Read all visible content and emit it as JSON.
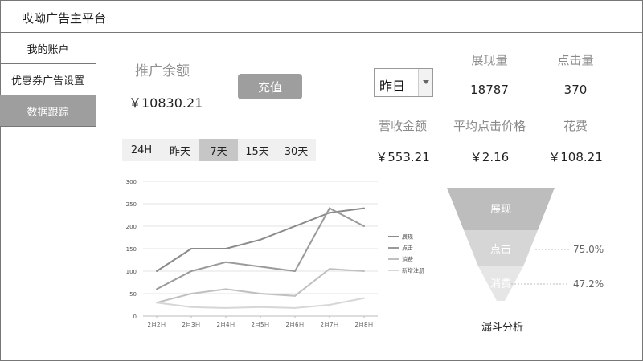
{
  "app": {
    "title": "哎呦广告主平台"
  },
  "sidebar": {
    "items": [
      {
        "label": "我的账户"
      },
      {
        "label": "优惠券广告设置"
      },
      {
        "label": "数据跟踪"
      }
    ],
    "active_index": 2
  },
  "balance": {
    "label": "推广余额",
    "value": "￥10830.21",
    "recharge_label": "充值"
  },
  "date_select": {
    "value": "昨日"
  },
  "stats": [
    {
      "label": "展现量",
      "value": "18787"
    },
    {
      "label": "点击量",
      "value": "370"
    },
    {
      "label": "营收金额",
      "value": "￥553.21"
    },
    {
      "label": "平均点击价格",
      "value": "￥2.16"
    },
    {
      "label": "花费",
      "value": "￥108.21"
    }
  ],
  "range_tabs": {
    "items": [
      "24H",
      "昨天",
      "7天",
      "15天",
      "30天"
    ],
    "active_index": 2
  },
  "chart_data": {
    "type": "line",
    "x": [
      "2月2日",
      "2月3日",
      "2月4日",
      "2月5日",
      "2月6日",
      "2月7日",
      "2月8日"
    ],
    "ylim": [
      0,
      300
    ],
    "yticks": [
      0,
      50,
      100,
      150,
      200,
      250,
      300
    ],
    "grid": true,
    "legend_position": "right",
    "series": [
      {
        "name": "展现",
        "color": "#8a8a8a",
        "values": [
          100,
          150,
          150,
          170,
          200,
          230,
          240
        ]
      },
      {
        "name": "点击",
        "color": "#9a9a9a",
        "values": [
          60,
          100,
          120,
          110,
          100,
          240,
          200
        ]
      },
      {
        "name": "消费",
        "color": "#c0c0c0",
        "values": [
          30,
          50,
          60,
          50,
          45,
          105,
          100
        ]
      },
      {
        "name": "新增注册",
        "color": "#d6d6d6",
        "values": [
          30,
          20,
          18,
          20,
          18,
          25,
          40
        ]
      }
    ]
  },
  "funnel": {
    "title": "漏斗分析",
    "stages": [
      {
        "label": "展现",
        "color": "#bdbdbd"
      },
      {
        "label": "点击",
        "color": "#d6d6d6"
      },
      {
        "label": "消费",
        "color": "#e6e6e6"
      }
    ],
    "rates": [
      "75.0%",
      "47.2%"
    ]
  }
}
